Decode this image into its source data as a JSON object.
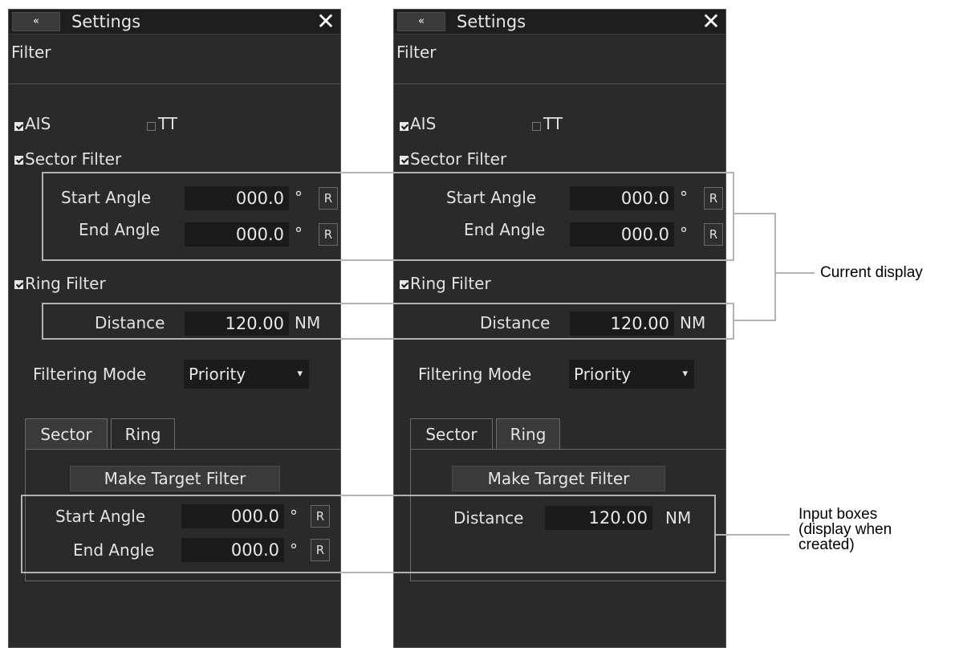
{
  "panels": [
    {
      "collapse_icon": "«",
      "title": "Settings",
      "close_icon": "✕",
      "section": "Filter",
      "ais": {
        "label": "AIS",
        "checked": true
      },
      "tt": {
        "label": "TT",
        "checked": false
      },
      "sector_filter": {
        "label": "Sector Filter",
        "checked": true
      },
      "start_angle": {
        "label": "Start Angle",
        "value": "000.0",
        "unit": "°",
        "reset": "R"
      },
      "end_angle": {
        "label": "End Angle",
        "value": "000.0",
        "unit": "°",
        "reset": "R"
      },
      "ring_filter": {
        "label": "Ring Filter",
        "checked": true
      },
      "distance": {
        "label": "Distance",
        "value": "120.00",
        "unit": "NM"
      },
      "filtering_mode": {
        "label": "Filtering Mode",
        "value": "Priority",
        "arrow": "▾"
      },
      "tabs": [
        "Sector",
        "Ring"
      ],
      "active_tab": "Sector",
      "make_target_filter": "Make Target Filter",
      "input_start_angle": {
        "label": "Start Angle",
        "value": "000.0",
        "unit": "°",
        "reset": "R"
      },
      "input_end_angle": {
        "label": "End Angle",
        "value": "000.0",
        "unit": "°",
        "reset": "R"
      }
    },
    {
      "collapse_icon": "«",
      "title": "Settings",
      "close_icon": "✕",
      "section": "Filter",
      "ais": {
        "label": "AIS",
        "checked": true
      },
      "tt": {
        "label": "TT",
        "checked": false
      },
      "sector_filter": {
        "label": "Sector Filter",
        "checked": true
      },
      "start_angle": {
        "label": "Start Angle",
        "value": "000.0",
        "unit": "°",
        "reset": "R"
      },
      "end_angle": {
        "label": "End Angle",
        "value": "000.0",
        "unit": "°",
        "reset": "R"
      },
      "ring_filter": {
        "label": "Ring Filter",
        "checked": true
      },
      "distance": {
        "label": "Distance",
        "value": "120.00",
        "unit": "NM"
      },
      "filtering_mode": {
        "label": "Filtering Mode",
        "value": "Priority",
        "arrow": "▾"
      },
      "tabs": [
        "Sector",
        "Ring"
      ],
      "active_tab": "Ring",
      "make_target_filter": "Make Target Filter",
      "input_distance": {
        "label": "Distance",
        "value": "120.00",
        "unit": "NM"
      }
    }
  ],
  "annotations": {
    "current_display": "Current display",
    "input_boxes": [
      "Input boxes",
      "(display when",
      "created)"
    ]
  }
}
